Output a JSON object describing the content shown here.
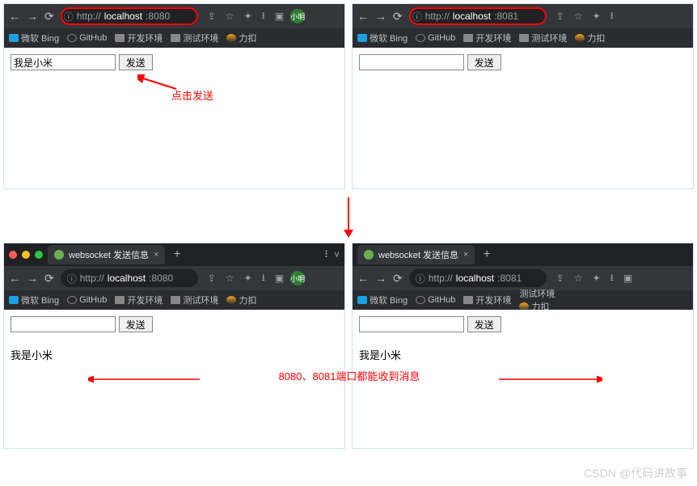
{
  "top": {
    "left": {
      "url_prefix": "http://",
      "url_host": "localhost",
      "url_port": ":8080",
      "input_value": "我是小米",
      "send_label": "发送",
      "avatar": "小明"
    },
    "right": {
      "url_prefix": "http://",
      "url_host": "localhost",
      "url_port": ":8081",
      "input_value": "",
      "send_label": "发送"
    }
  },
  "bottom": {
    "left": {
      "tab_title": "websocket 发送信息",
      "url_prefix": "http://",
      "url_host": "localhost",
      "url_port": ":8080",
      "input_value": "",
      "send_label": "发送",
      "message": "我是小米",
      "avatar": "小明"
    },
    "right": {
      "tab_title": "websocket 发送信息",
      "url_prefix": "http://",
      "url_host": "localhost",
      "url_port": ":8081",
      "input_value": "",
      "send_label": "发送",
      "message": "我是小米"
    }
  },
  "bookmarks": {
    "bing": "微软 Bing",
    "github": "GitHub",
    "dev": "开发环境",
    "test": "测试环境",
    "lk": "力扣"
  },
  "annotations": {
    "click_send": "点击发送",
    "both_receive": "8080、8081端口都能收到消息"
  },
  "watermark": "CSDN @代码讲故事"
}
